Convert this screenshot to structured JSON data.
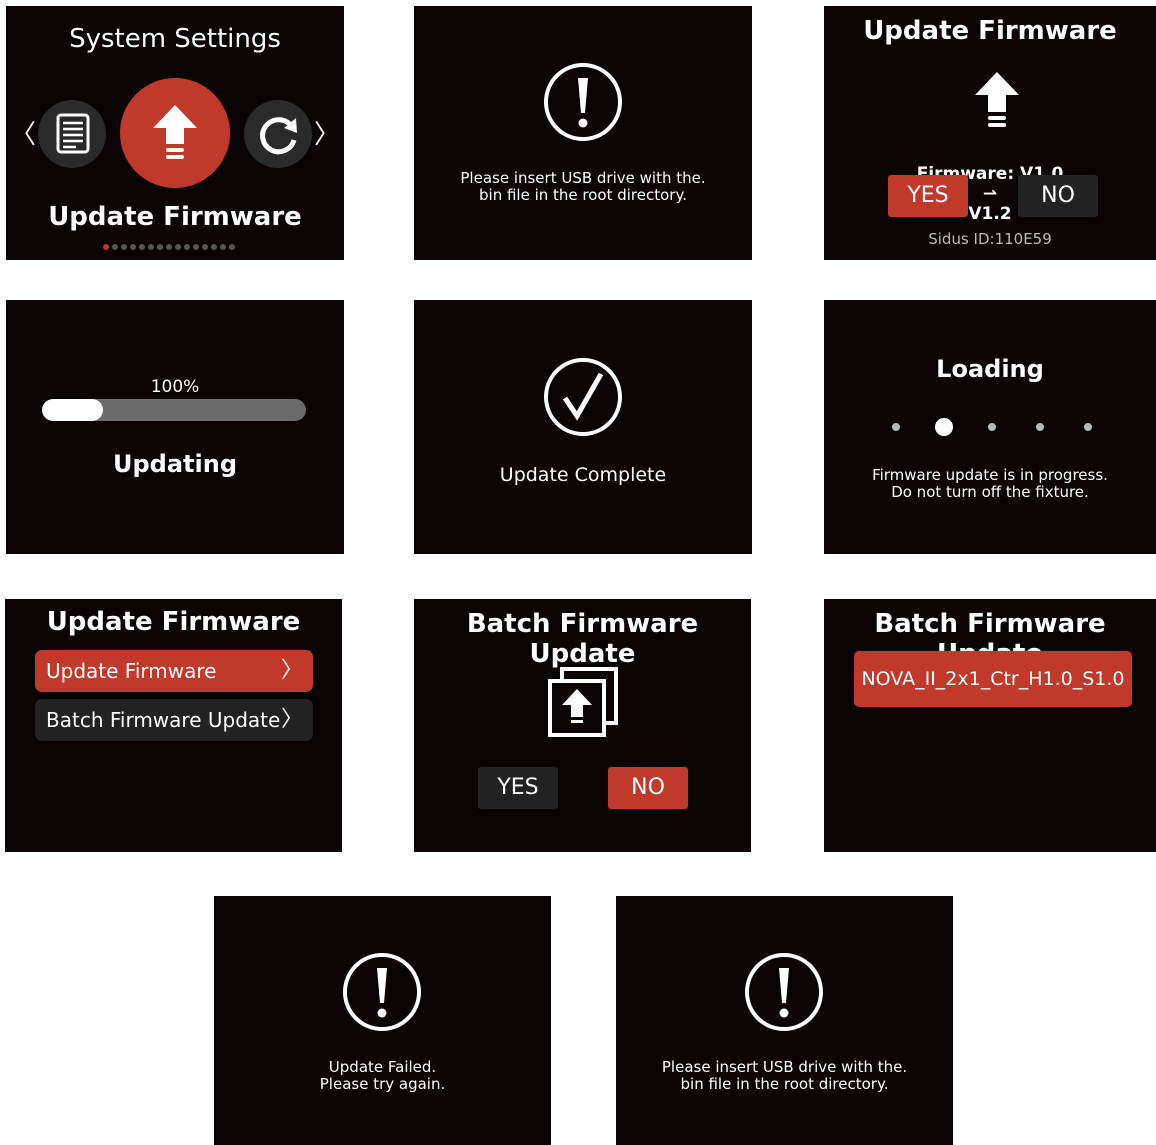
{
  "colors": {
    "panel_bg": "#0a0303",
    "accent_red": "#c0392b",
    "dark_button": "#222222",
    "track_grey": "#6b6b6b"
  },
  "screen1": {
    "title": "System Settings",
    "left_arrow": "〈",
    "right_arrow": "〉",
    "icons": [
      "document-icon",
      "upload-arrow-icon",
      "refresh-icon"
    ],
    "selected_label": "Update Firmware",
    "page_dots": {
      "count": 15,
      "active_index": 0
    }
  },
  "screen2": {
    "message": "Please insert USB drive with the.\nbin file in the root directory."
  },
  "screen3": {
    "title": "Update Firmware",
    "firmware_label": "Firmware: V1.0",
    "arrow": "⇀",
    "firmware_target": "V1.2",
    "yes_label": "YES",
    "no_label": "NO",
    "sidus_id": "Sidus ID:110E59"
  },
  "screen4": {
    "progress_text": "100%",
    "progress_fraction": 0.23,
    "status": "Updating"
  },
  "screen5": {
    "message": "Update Complete"
  },
  "screen6": {
    "title": "Loading",
    "dots": {
      "count": 5,
      "active_index": 1
    },
    "message": "Firmware update is in progress.\nDo not turn off the fixture."
  },
  "screen7": {
    "title": "Update Firmware",
    "items": [
      {
        "label": "Update Firmware",
        "selected": true
      },
      {
        "label": "Batch Firmware Update",
        "selected": false
      }
    ],
    "chevron": "〉"
  },
  "screen8": {
    "title": "Batch Firmware Update",
    "yes_label": "YES",
    "no_label": "NO"
  },
  "screen9": {
    "title": "Batch Firmware Update",
    "file_label": "NOVA_II_2x1_Ctr_H1.0_S1.0"
  },
  "screen10": {
    "message": "Update Failed.\nPlease try again."
  },
  "screen11": {
    "message": "Please insert USB drive with the.\nbin file in the root directory."
  }
}
